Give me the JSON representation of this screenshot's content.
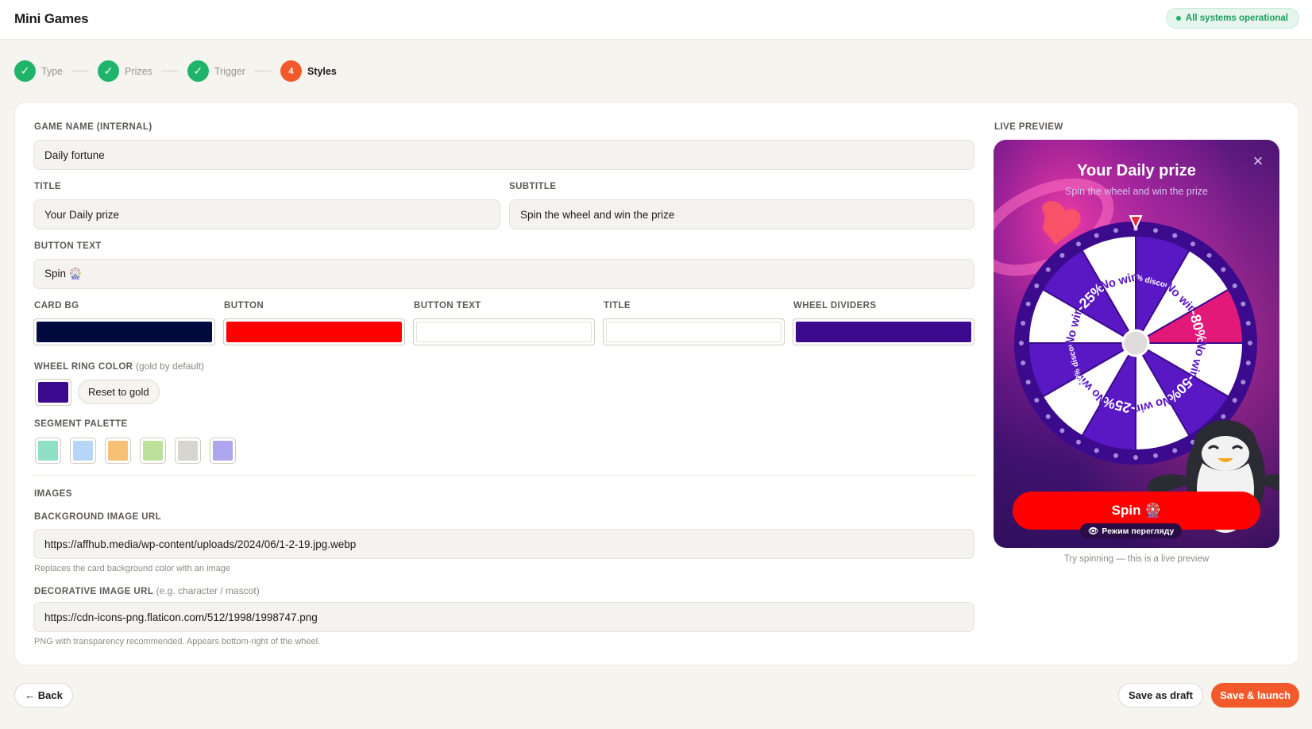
{
  "header": {
    "title": "Mini Games",
    "status": "All systems operational"
  },
  "steps": [
    {
      "label": "Type",
      "icon": "check-icon",
      "done": true
    },
    {
      "label": "Prizes",
      "icon": "check-icon",
      "done": true
    },
    {
      "label": "Trigger",
      "icon": "check-icon",
      "done": true
    },
    {
      "label": "Styles",
      "number": "4",
      "done": false
    }
  ],
  "form": {
    "game_name": {
      "label": "GAME NAME (INTERNAL)",
      "value": "Daily fortune"
    },
    "title": {
      "label": "TITLE",
      "value": "Your Daily prize"
    },
    "subtitle": {
      "label": "SUBTITLE",
      "value": "Spin the wheel and win the prize"
    },
    "button_text": {
      "label": "BUTTON TEXT",
      "value": "Spin 🎡"
    },
    "colors": {
      "card_bg": {
        "label": "CARD BG",
        "value": "#000a3d"
      },
      "button": {
        "label": "BUTTON",
        "value": "#ff0000"
      },
      "button_text": {
        "label": "BUTTON TEXT",
        "value": "#ffffff"
      },
      "title": {
        "label": "TITLE",
        "value": "#ffffff"
      },
      "wheel_dividers": {
        "label": "WHEEL DIVIDERS",
        "value": "#3c0a8c"
      }
    },
    "wheel_ring": {
      "label": "WHEEL RING COLOR",
      "hint": "(gold by default)",
      "value": "#3c0a8c",
      "reset_label": "Reset to gold"
    },
    "segment_palette": {
      "label": "SEGMENT PALETTE",
      "colors": [
        "#8fe0c5",
        "#b6d6f7",
        "#f7c175",
        "#bde19d",
        "#d7d5cf",
        "#ada6ef"
      ]
    },
    "images": {
      "section_label": "IMAGES",
      "background_url": {
        "label": "BACKGROUND IMAGE URL",
        "value": "https://affhub.media/wp-content/uploads/2024/06/1-2-19.jpg.webp",
        "help": "Replaces the card background color with an image"
      },
      "decorative_url": {
        "label": "DECORATIVE IMAGE URL",
        "hint": "(e.g. character / mascot)",
        "value": "https://cdn-icons-png.flaticon.com/512/1998/1998747.png",
        "help": "PNG with transparency recommended. Appears bottom-right of the wheel."
      }
    }
  },
  "preview": {
    "label": "LIVE PREVIEW",
    "title": "Your Daily prize",
    "subtitle": "Spin the wheel and win the prize",
    "button": "Spin 🎡",
    "view_mode": "Режим перегляду",
    "caption": "Try spinning — this is a live preview",
    "colors": {
      "segment_dark": "#5a18c4",
      "segment_light": "#ffffff",
      "segment_highlight": "#e3197a",
      "ring": "#3c0a8c",
      "button": "#ff0000"
    },
    "segments": [
      {
        "label": "10% discount",
        "fill": "#5a18c4",
        "text": "#ffffff"
      },
      {
        "label": "No win",
        "fill": "#ffffff",
        "text": "#5a18c4"
      },
      {
        "label": "-80%",
        "fill": "#e3197a",
        "text": "#ffffff"
      },
      {
        "label": "No win",
        "fill": "#ffffff",
        "text": "#5a18c4"
      },
      {
        "label": "-50%",
        "fill": "#5a18c4",
        "text": "#ffffff"
      },
      {
        "label": "No win",
        "fill": "#ffffff",
        "text": "#5a18c4"
      },
      {
        "label": "-25%",
        "fill": "#5a18c4",
        "text": "#ffffff"
      },
      {
        "label": "No win",
        "fill": "#ffffff",
        "text": "#5a18c4"
      },
      {
        "label": "10% discount",
        "fill": "#5a18c4",
        "text": "#ffffff"
      },
      {
        "label": "No win",
        "fill": "#ffffff",
        "text": "#5a18c4"
      },
      {
        "label": "-25%",
        "fill": "#5a18c4",
        "text": "#ffffff"
      },
      {
        "label": "No win",
        "fill": "#ffffff",
        "text": "#5a18c4"
      }
    ]
  },
  "footer": {
    "back": "← Back",
    "draft": "Save as draft",
    "launch": "Save & launch"
  }
}
